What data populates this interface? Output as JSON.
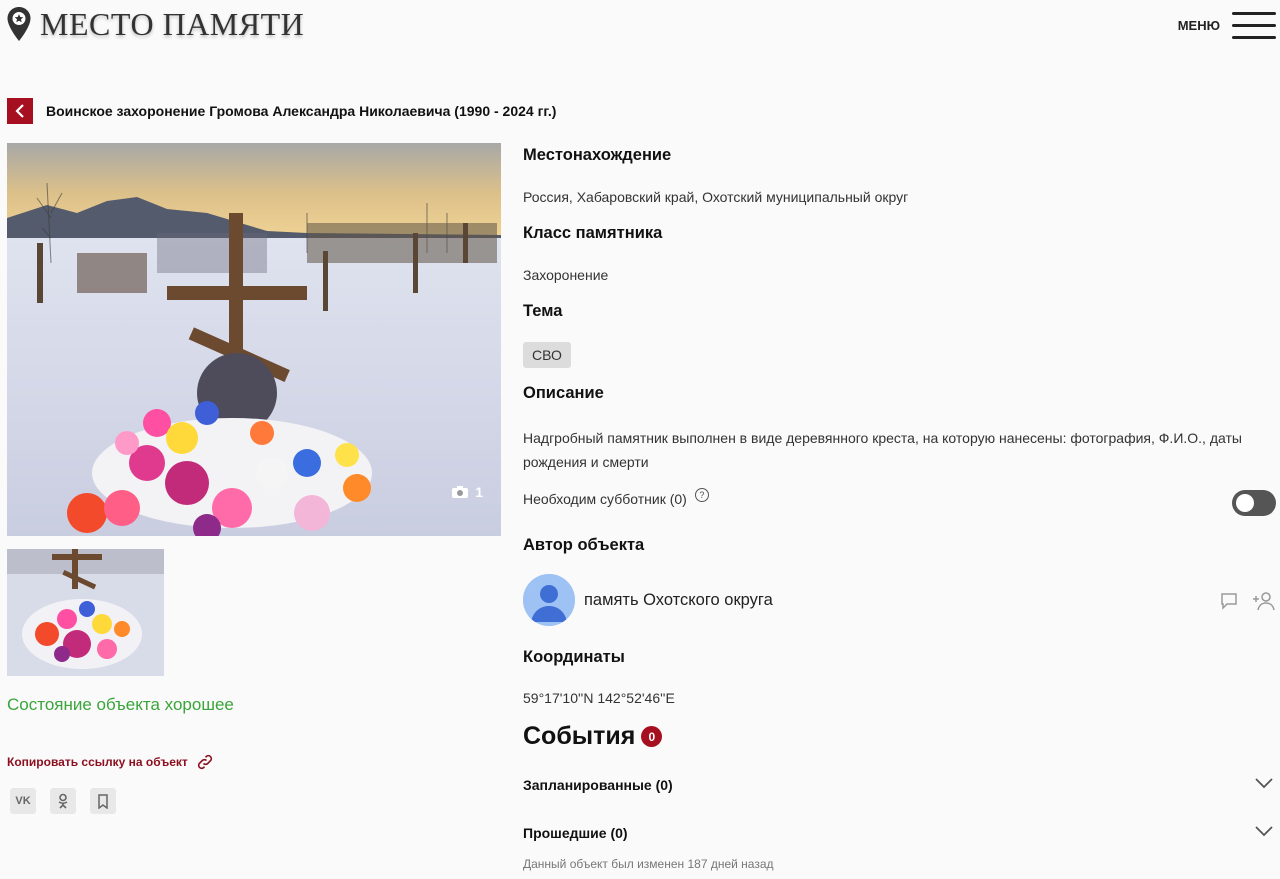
{
  "header": {
    "logo_text": "МЕСТО ПАМЯТИ",
    "menu_label": "МЕНЮ"
  },
  "page": {
    "title": "Воинское захоронение Громова Александра Николаевича (1990 - 2024 гг.)"
  },
  "gallery": {
    "photo_count": "1"
  },
  "left": {
    "state_text": "Состояние объекта хорошее",
    "copy_link_label": "Копировать ссылку на объект",
    "share": [
      {
        "label": "VK"
      },
      {
        "label": "OK"
      },
      {
        "label": "bookmark"
      }
    ]
  },
  "details": {
    "location_heading": "Местонахождение",
    "location_value": "Россия, Хабаровский край, Охотский муниципальный округ",
    "class_heading": "Класс памятника",
    "class_value": "Захоронение",
    "theme_heading": "Тема",
    "theme_tag": "СВО",
    "description_heading": "Описание",
    "description_value": "Надгробный памятник выполнен в виде деревянного креста, на которую нанесены: фотография, Ф.И.О., даты рождения и смерти",
    "subbotnik_label": "Необходим субботник (0)",
    "subbotnik_on": false,
    "author_heading": "Автор объекта",
    "author_name": "память Охотского округа",
    "coords_heading": "Координаты",
    "coords_value": "59°17'10''N 142°52'46''E"
  },
  "events": {
    "title": "События",
    "count": "0",
    "planned_label": "Запланированные (0)",
    "past_label": "Прошедшие (0)"
  },
  "footer": {
    "changed_text": "Данный объект был изменен 187 дней назад"
  },
  "colors": {
    "accent": "#a50f1f",
    "state_good": "#3aa53a",
    "background": "#fafafa"
  }
}
